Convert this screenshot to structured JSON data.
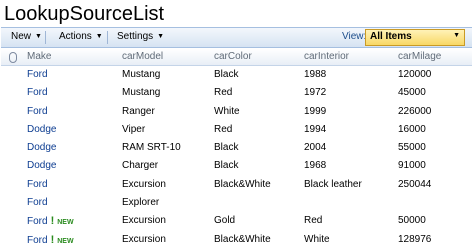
{
  "page": {
    "title": "LookupSourceList"
  },
  "toolbar": {
    "new_label": "New",
    "actions_label": "Actions",
    "settings_label": "Settings",
    "view_label": "View:",
    "view_value": "All Items"
  },
  "table": {
    "columns": [
      "Make",
      "carModel",
      "carColor",
      "carInterior",
      "carMilage"
    ],
    "rows": [
      {
        "make": "Ford",
        "model": "Mustang",
        "color": "Black",
        "interior": "1988",
        "milage": "120000",
        "is_new": false
      },
      {
        "make": "Ford",
        "model": "Mustang",
        "color": "Red",
        "interior": "1972",
        "milage": "45000",
        "is_new": false
      },
      {
        "make": "Ford",
        "model": "Ranger",
        "color": "White",
        "interior": "1999",
        "milage": "226000",
        "is_new": false
      },
      {
        "make": "Dodge",
        "model": "Viper",
        "color": "Red",
        "interior": "1994",
        "milage": "16000",
        "is_new": false
      },
      {
        "make": "Dodge",
        "model": "RAM SRT-10",
        "color": "Black",
        "interior": "2004",
        "milage": "55000",
        "is_new": false
      },
      {
        "make": "Dodge",
        "model": "Charger",
        "color": "Black",
        "interior": "1968",
        "milage": "91000",
        "is_new": false
      },
      {
        "make": "Ford",
        "model": "Excursion",
        "color": "Black&White",
        "interior": "Black leather",
        "milage": "250044",
        "is_new": false
      },
      {
        "make": "Ford",
        "model": "Explorer",
        "color": "",
        "interior": "",
        "milage": "",
        "is_new": false
      },
      {
        "make": "Ford",
        "model": "Excursion",
        "color": "Gold",
        "interior": "Red",
        "milage": "50000",
        "is_new": true
      },
      {
        "make": "Ford",
        "model": "Excursion",
        "color": "Black&White",
        "interior": "White",
        "milage": "128976",
        "is_new": true
      }
    ],
    "new_badge": "NEW",
    "new_icon": "!"
  },
  "colors": {
    "accent": "#0d3d91",
    "new_badge": "#2a8b1e",
    "toolbar_bg": "#d6e3f2",
    "view_select_bg": "#f8d866"
  }
}
